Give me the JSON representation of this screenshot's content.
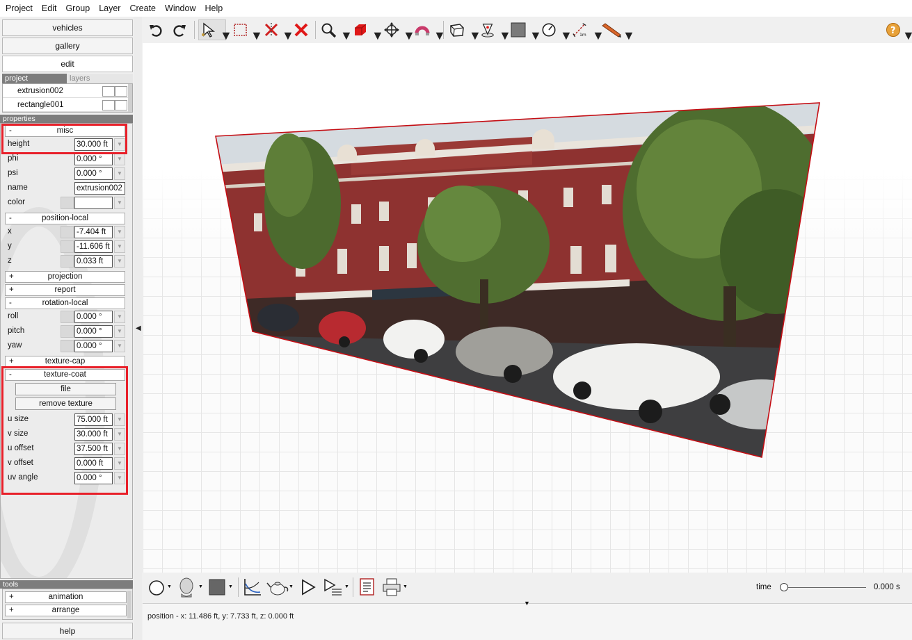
{
  "menu": [
    "Project",
    "Edit",
    "Group",
    "Layer",
    "Create",
    "Window",
    "Help"
  ],
  "nav": {
    "vehicles": "vehicles",
    "gallery": "gallery",
    "edit": "edit",
    "help": "help"
  },
  "tabs": {
    "project": "project",
    "layers": "layers"
  },
  "layers": [
    {
      "name": "extrusion002"
    },
    {
      "name": "rectangle001"
    }
  ],
  "properties_header": "properties",
  "misc": {
    "title": "misc",
    "sign": "-",
    "height": {
      "label": "height",
      "value": "30.000 ft"
    },
    "phi": {
      "label": "phi",
      "value": "0.000 °"
    },
    "psi": {
      "label": "psi",
      "value": "0.000 °"
    },
    "name": {
      "label": "name",
      "value": "extrusion002"
    },
    "color": {
      "label": "color",
      "value": ""
    }
  },
  "position_local": {
    "title": "position-local",
    "sign": "-",
    "x": {
      "label": "x",
      "value": "-7.404 ft"
    },
    "y": {
      "label": "y",
      "value": "-11.606 ft"
    },
    "z": {
      "label": "z",
      "value": "0.033 ft"
    }
  },
  "projection": {
    "title": "projection",
    "sign": "+"
  },
  "report": {
    "title": "report",
    "sign": "+"
  },
  "rotation_local": {
    "title": "rotation-local",
    "sign": "-",
    "roll": {
      "label": "roll",
      "value": "0.000 °"
    },
    "pitch": {
      "label": "pitch",
      "value": "0.000 °"
    },
    "yaw": {
      "label": "yaw",
      "value": "0.000 °"
    }
  },
  "texture_cap": {
    "title": "texture-cap",
    "sign": "+"
  },
  "texture_coat": {
    "title": "texture-coat",
    "sign": "-",
    "file_button": "file",
    "remove_button": "remove texture",
    "u_size": {
      "label": "u size",
      "value": "75.000 ft"
    },
    "v_size": {
      "label": "v size",
      "value": "30.000 ft"
    },
    "u_offset": {
      "label": "u offset",
      "value": "37.500 ft"
    },
    "v_offset": {
      "label": "v offset",
      "value": "0.000 ft"
    },
    "uv_angle": {
      "label": "uv angle",
      "value": "0.000 °"
    }
  },
  "tools": {
    "header": "tools",
    "items": [
      {
        "title": "animation",
        "sign": "+"
      },
      {
        "title": "arrange",
        "sign": "+"
      }
    ]
  },
  "toolbar_icons": [
    "undo-icon",
    "redo-icon",
    "select-icon",
    "box-select-icon",
    "trim-icon",
    "delete-icon",
    "zoom-icon",
    "solid-icon",
    "move-icon",
    "magnet-icon",
    "view-box-icon",
    "camera-icon",
    "material-icon",
    "gauge-icon",
    "measure-icon",
    "pencil-icon",
    "help-icon"
  ],
  "measure_label": "1m",
  "time": {
    "label": "time",
    "value": "0.000 s",
    "fraction": 0
  },
  "status": {
    "position": "position - x: 11.486 ft, y: 7.733 ft, z: 0.000 ft"
  },
  "colors": {
    "highlight": "#e8202a",
    "wall_edge": "#c40e14",
    "brick": "#8e3230",
    "sky": "#d5dbe0",
    "panel": "#f0f0f0"
  }
}
